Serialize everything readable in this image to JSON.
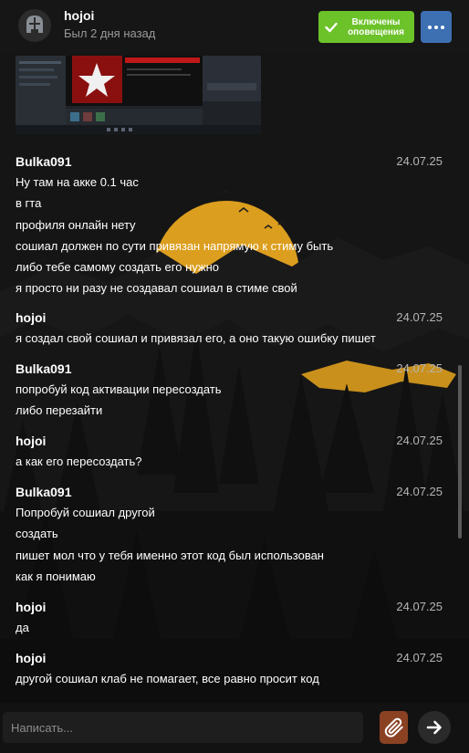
{
  "header": {
    "user_name": "hojoi",
    "user_status": "Был 2 дня назад",
    "notif_line1": "Включены",
    "notif_line2": "оповещения",
    "avatar_icon": "knight-helmet-icon",
    "more_icon": "ellipsis-icon"
  },
  "attachment": {
    "type": "screenshot-preview"
  },
  "messages": [
    {
      "author": "Bulka091",
      "date": "24.07.25",
      "lines": [
        "Ну там на акке 0.1 час",
        "в гта",
        "профиля онлайн нету",
        "сошиал должен по сути привязан напрямую к стиму быть",
        "либо тебе самому создать его нужно",
        "я просто ни разу не создавал сошиал в стиме свой"
      ]
    },
    {
      "author": "hojoi",
      "date": "24.07.25",
      "lines": [
        "я создал свой сошиал и привязал его, а оно такую ошибку пишет"
      ]
    },
    {
      "author": "Bulka091",
      "date": "24.07.25",
      "lines": [
        "попробуй код активации пересоздать",
        "либо перезайти"
      ]
    },
    {
      "author": "hojoi",
      "date": "24.07.25",
      "lines": [
        "а как его пересоздать?"
      ]
    },
    {
      "author": "Bulka091",
      "date": "24.07.25",
      "lines": [
        "Попробуй сошиал другой",
        "создать",
        "пишет мол что у тебя именно этот код был использован",
        "как я понимаю"
      ]
    },
    {
      "author": "hojoi",
      "date": "24.07.25",
      "lines": [
        "да"
      ]
    },
    {
      "author": "hojoi",
      "date": "24.07.25",
      "lines": [
        "другой сошиал клаб не помагает, все равно просит код"
      ]
    }
  ],
  "composer": {
    "placeholder": "Написать...",
    "attach_icon": "paperclip-icon",
    "send_icon": "arrow-right-icon"
  },
  "colors": {
    "notif_green": "#6cc229",
    "more_blue": "#3d6fb3",
    "attach_brown": "#8a4223",
    "sun_orange": "#e0a020"
  }
}
